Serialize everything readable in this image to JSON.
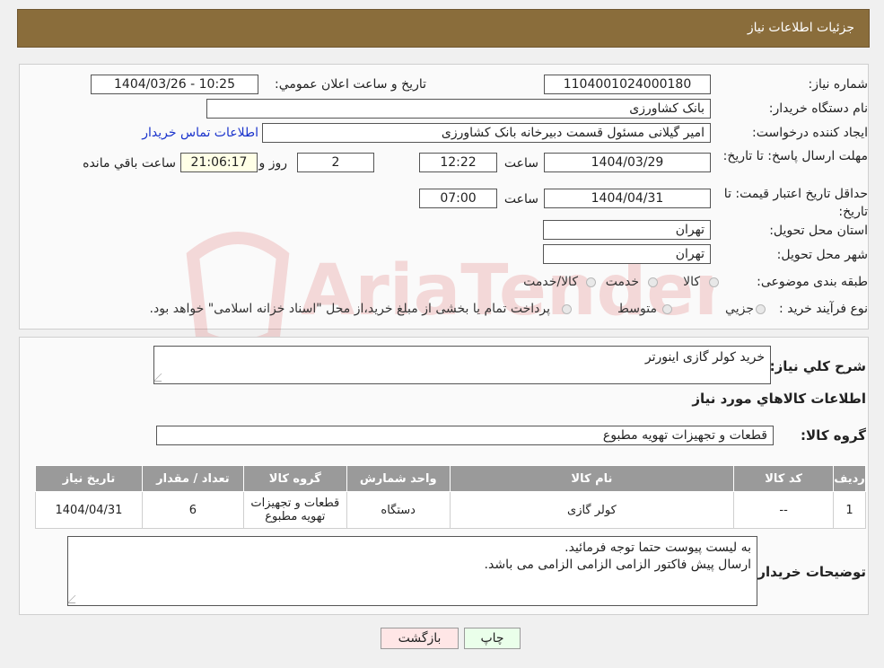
{
  "header": {
    "title": "جزئیات اطلاعات نیاز"
  },
  "watermark": {
    "text": "AriaTender.neT"
  },
  "form": {
    "need_number_label": "شماره نیاز:",
    "need_number": "1104001024000180",
    "announce_label": "تاریخ و ساعت اعلان عمومي:",
    "announce_value": "1404/03/26 - 10:25",
    "buyer_org_label": "نام دستگاه خریدار:",
    "buyer_org": "بانک کشاورزی",
    "requester_label": "ایجاد کننده درخواست:",
    "requester": "امیر گیلانی مسئول قسمت دبیرخانه بانک کشاورزی",
    "contact_link": "اطلاعات تماس خریدار",
    "reply_deadline_label": "مهلت ارسال پاسخ: تا تاریخ:",
    "reply_date": "1404/03/29",
    "time_label": "ساعت",
    "reply_time": "12:22",
    "days_value": "2",
    "days_label": "روز و",
    "remaining_time": "21:06:17",
    "remaining_label": "ساعت باقي مانده",
    "price_validity_label": "حداقل تاریخ اعتبار قیمت: تا تاریخ:",
    "price_validity_date": "1404/04/31",
    "price_validity_time_label": "ساعت",
    "price_validity_time": "07:00",
    "province_label": "استان محل تحویل:",
    "province": "تهران",
    "city_label": "شهر محل تحویل:",
    "city": "تهران",
    "category_label": "طبقه بندی موضوعی:",
    "category_options": [
      "کالا",
      "خدمت",
      "کالا/خدمت"
    ],
    "process_label": "نوع فرآیند خرید :",
    "process_options": [
      "جزيي",
      "متوسط"
    ],
    "process_note": "پرداخت تمام یا بخشی از مبلغ خرید،از محل \"اسناد خزانه اسلامی\" خواهد بود."
  },
  "details": {
    "description_label": "شرح كلي نياز:",
    "description": "خرید کولر گازی اینورتر",
    "goods_info_title": "اطلاعات کالاهاي مورد نياز",
    "goods_group_label": "گروه کالا:",
    "goods_group": "قطعات و تجهیزات تهویه مطبوع",
    "table_headers": [
      "رديف",
      "کد کالا",
      "نام کالا",
      "واحد شمارش",
      "گروه کالا",
      "تعداد / مقدار",
      "تاریخ نیاز"
    ],
    "rows": [
      [
        "1",
        "--",
        "کولر گازی",
        "دستگاه",
        "قطعات و تجهیزات تهویه مطبوع",
        "6",
        "1404/04/31"
      ]
    ],
    "buyer_notes_label": "توضیحات خریدار:",
    "buyer_notes_line1": "به لیست پیوست حتما توجه فرمائید.",
    "buyer_notes_line2": "ارسال پیش فاکتور الزامی الزامی الزامی می باشد."
  },
  "buttons": {
    "print": "چاپ",
    "back": "بازگشت"
  },
  "colors": {
    "header_bg": "#8a6d3b",
    "print_bg": "#eaffea",
    "back_bg": "#ffe6e6",
    "link": "#1a33cc"
  }
}
